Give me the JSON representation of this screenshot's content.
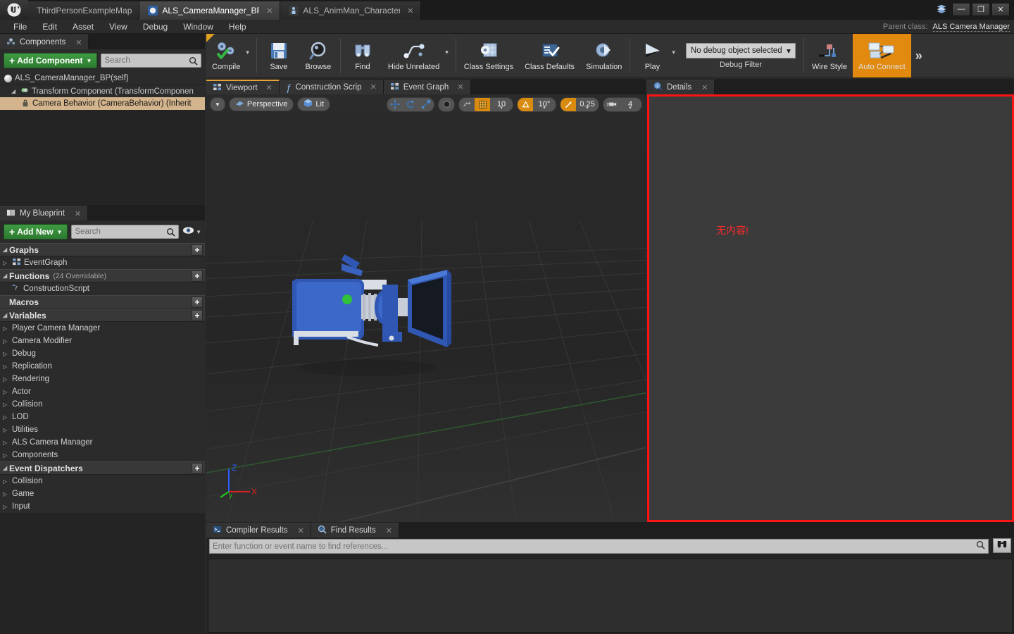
{
  "window": {
    "tabs": [
      {
        "label": "ThirdPersonExampleMap",
        "icon": "map-icon",
        "state": "inactive",
        "closable": false
      },
      {
        "label": "ALS_CameraManager_BP",
        "icon": "blueprint-sphere-icon",
        "state": "active",
        "closable": true
      },
      {
        "label": "ALS_AnimMan_Character",
        "icon": "character-icon",
        "state": "inactive",
        "closable": true
      }
    ],
    "controls": {
      "minimize": "—",
      "restore": "❐",
      "close": "✕"
    }
  },
  "menubar": {
    "items": [
      "File",
      "Edit",
      "Asset",
      "View",
      "Debug",
      "Window",
      "Help"
    ],
    "parent_class_label": "Parent class:",
    "parent_class_value": "ALS Camera Manager"
  },
  "toolbar": {
    "items": [
      {
        "label": "Compile",
        "icon": "compile-gears-check-icon",
        "has_dropdown": true,
        "highlighted": false
      },
      {
        "label": "Save",
        "icon": "floppy-disk-icon",
        "has_dropdown": false,
        "highlighted": false
      },
      {
        "label": "Browse",
        "icon": "magnifier-sphere-icon",
        "has_dropdown": false,
        "highlighted": false
      },
      {
        "label": "Find",
        "icon": "binoculars-icon",
        "has_dropdown": false,
        "highlighted": false
      },
      {
        "label": "Hide Unrelated",
        "icon": "node-wire-icon",
        "has_dropdown": true,
        "highlighted": false
      },
      {
        "label": "Class Settings",
        "icon": "class-settings-gear-icon",
        "has_dropdown": false,
        "highlighted": false
      },
      {
        "label": "Class Defaults",
        "icon": "class-defaults-check-icon",
        "has_dropdown": false,
        "highlighted": false
      },
      {
        "label": "Simulation",
        "icon": "simulation-gear-play-icon",
        "has_dropdown": false,
        "highlighted": false
      },
      {
        "label": "Play",
        "icon": "play-triangle-icon",
        "has_dropdown": true,
        "highlighted": false
      }
    ],
    "debug": {
      "selected": "No debug object selected",
      "caption": "Debug Filter"
    },
    "right_items": [
      {
        "label": "Wire Style",
        "icon": "wire-style-icon",
        "highlighted": false
      },
      {
        "label": "Auto Connect",
        "icon": "auto-connect-nodes-icon",
        "highlighted": true
      }
    ],
    "overflow": "»",
    "accent_orange": "#e2890f"
  },
  "components_panel": {
    "tab": {
      "label": "Components",
      "icon": "components-icon"
    },
    "add_button": "Add Component",
    "search_placeholder": "Search",
    "tree": [
      {
        "label": "ALS_CameraManager_BP(self)",
        "icon": "sphere-icon",
        "indent": 0,
        "expandable": false,
        "selected": false
      },
      {
        "label": "Transform Component (TransformComponen",
        "icon": "transform-icon",
        "indent": 1,
        "expandable": true,
        "selected": false
      },
      {
        "label": "Camera Behavior (CameraBehavior) (Inherit",
        "icon": "lock-component-icon",
        "indent": 2,
        "expandable": false,
        "selected": true
      }
    ]
  },
  "myblueprint_panel": {
    "tab": {
      "label": "My Blueprint",
      "icon": "book-icon"
    },
    "add_button": "Add New",
    "search_placeholder": "Search",
    "eye_icon": "eye-icon",
    "sections": [
      {
        "name": "Graphs",
        "collapsible": true,
        "add": "+",
        "items": [
          {
            "label": "EventGraph",
            "icon": "graph-icon",
            "expandable": true
          }
        ]
      },
      {
        "name": "Functions",
        "sub": "(24 Overridable)",
        "collapsible": true,
        "add": "+",
        "items": [
          {
            "label": "ConstructionScript",
            "icon": "function-icon",
            "expandable": false
          }
        ]
      },
      {
        "name": "Macros",
        "collapsible": false,
        "add": "+",
        "items": []
      },
      {
        "name": "Variables",
        "collapsible": true,
        "add": "+",
        "items": [
          {
            "label": "Player Camera Manager",
            "expandable": true
          },
          {
            "label": "Camera Modifier",
            "expandable": true
          },
          {
            "label": "Debug",
            "expandable": true
          },
          {
            "label": "Replication",
            "expandable": true
          },
          {
            "label": "Rendering",
            "expandable": true
          },
          {
            "label": "Actor",
            "expandable": true
          },
          {
            "label": "Collision",
            "expandable": true
          },
          {
            "label": "LOD",
            "expandable": true
          },
          {
            "label": "Utilities",
            "expandable": true
          },
          {
            "label": "ALS Camera Manager",
            "expandable": true
          },
          {
            "label": "Components",
            "expandable": true
          }
        ]
      },
      {
        "name": "Event Dispatchers",
        "collapsible": true,
        "add": "+",
        "items": [
          {
            "label": "Collision",
            "expandable": true
          },
          {
            "label": "Game",
            "expandable": true
          },
          {
            "label": "Input",
            "expandable": true
          }
        ]
      }
    ]
  },
  "center_panel": {
    "tabs": [
      {
        "label": "Viewport",
        "icon": "viewport-icon",
        "active": true
      },
      {
        "label": "Construction Scrip",
        "icon": "function-f-icon",
        "active": false
      },
      {
        "label": "Event Graph",
        "icon": "graph-icon",
        "active": false
      }
    ],
    "viewport_toolbar": {
      "menu_icon": "viewport-options-caret",
      "view_mode": "Perspective",
      "view_mode_icon": "perspective-icon",
      "lighting": "Lit",
      "lighting_icon": "cube-icon",
      "transform_tools": [
        "translate-icon",
        "rotate-icon",
        "scale-icon"
      ],
      "coord_icon": "world-coord-icon",
      "surface_snap_icon": "surface-snap-icon",
      "grid_snap_icon": "grid-snap-icon",
      "grid_snap_value": "10",
      "angle_snap_icon": "angle-snap-icon",
      "angle_snap_value": "10°",
      "scale_snap_icon": "scale-snap-icon",
      "scale_snap_value": "0.25",
      "camera_speed_icon": "camera-speed-icon",
      "camera_speed_value": "4"
    },
    "axis_gizmo": {
      "x": "X",
      "y": "y",
      "z": "Z",
      "x_color": "#e02020",
      "y_color": "#22cc22",
      "z_color": "#2b5cff"
    },
    "scene_object": "blue-camera-mesh"
  },
  "details_panel": {
    "tab": {
      "label": "Details",
      "icon": "details-info-icon"
    },
    "annotation_text": "无内容!",
    "annotation_color": "#ff2a2a",
    "border_color": "#fc1414"
  },
  "bottom_panel": {
    "tabs": [
      {
        "label": "Compiler Results",
        "icon": "compiler-results-icon",
        "active": false
      },
      {
        "label": "Find Results",
        "icon": "find-results-icon",
        "active": true
      }
    ],
    "find_placeholder": "Enter function or event name to find references...",
    "search_icon": "magnifier-icon",
    "find_button_icon": "binoculars-icon"
  }
}
